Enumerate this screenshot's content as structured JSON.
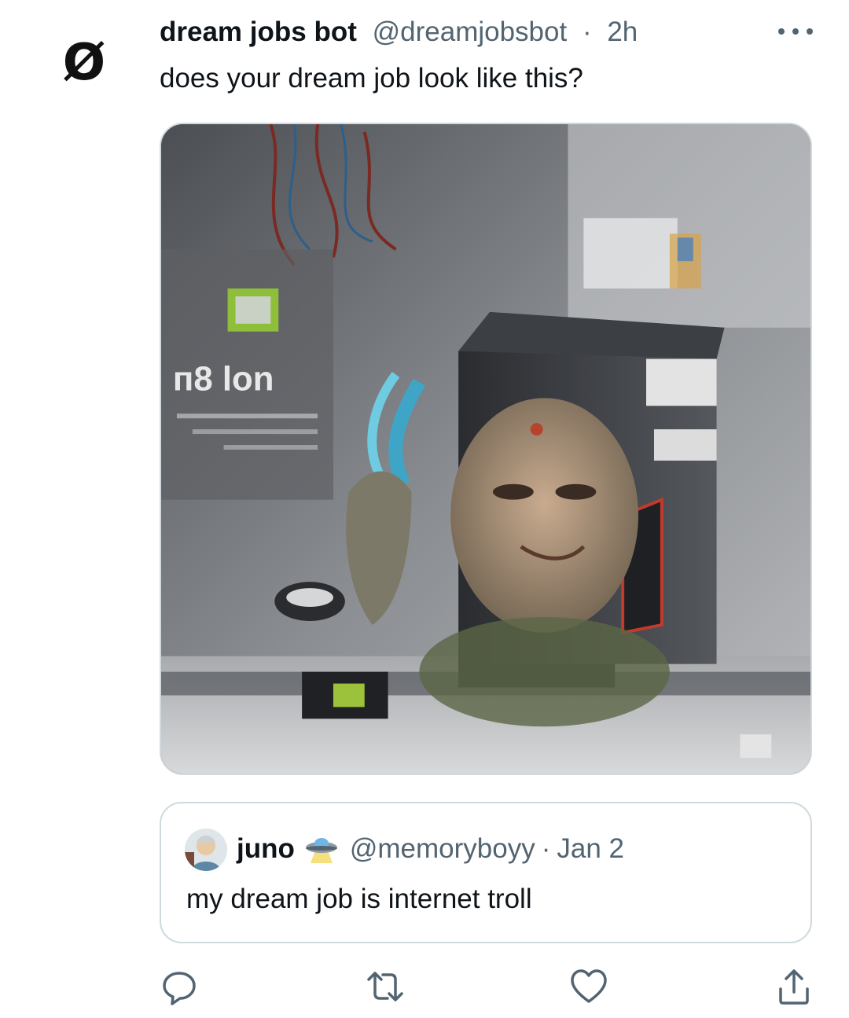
{
  "tweet": {
    "avatar_glyph": "Ø",
    "display_name": "dream jobs bot",
    "handle": "@dreamjobsbot",
    "separator": "·",
    "time": "2h",
    "text": "does your dream job look like this?",
    "media_icon": "ai-generated-troll-computer-image"
  },
  "quote": {
    "display_name": "juno",
    "badge_icon": "ufo-emoji-icon",
    "handle": "@memoryboyy",
    "separator": "·",
    "date": "Jan 2",
    "text": "my dream job is internet troll"
  },
  "actions": [
    "reply-icon",
    "retweet-icon",
    "like-icon",
    "share-icon"
  ],
  "colors": {
    "text_primary": "#0f1419",
    "text_secondary": "#536471",
    "border": "#cfd9de"
  }
}
